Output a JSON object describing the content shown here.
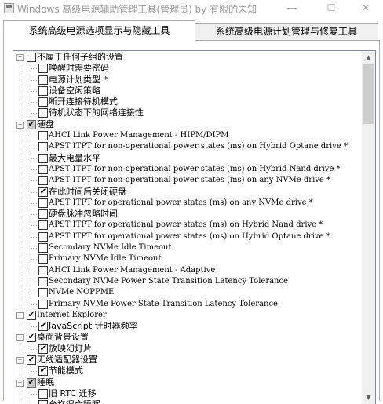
{
  "window": {
    "title": "Windows 高级电源辅助管理工具(管理员)  by 有限的未知",
    "minimize_glyph": "—",
    "maximize_glyph": "☐",
    "close_glyph": "✕"
  },
  "tabs": [
    {
      "label": "系统高级电源选项显示与隐藏工具",
      "active": true
    },
    {
      "label": "系统高级电源计划管理与修复工具",
      "active": false
    }
  ],
  "tree": [
    {
      "label": "不属于任何子组的设置",
      "level": 0,
      "expander": "−",
      "check": "none",
      "mono": false
    },
    {
      "label": "唤醒时需要密码",
      "level": 1,
      "check": "none",
      "mono": false
    },
    {
      "label": "电源计划类型 *",
      "level": 1,
      "check": "none",
      "mono": false
    },
    {
      "label": "设备空闲策略",
      "level": 1,
      "check": "none",
      "mono": false
    },
    {
      "label": "断开连接待机模式",
      "level": 1,
      "check": "none",
      "mono": false
    },
    {
      "label": "待机状态下的网络连接性",
      "level": 1,
      "check": "none",
      "mono": false
    },
    {
      "label": "硬盘",
      "level": 0,
      "expander": "−",
      "check": "partial",
      "mono": false
    },
    {
      "label": "AHCI Link Power Management - HIPM/DIPM",
      "level": 1,
      "check": "none",
      "mono": true
    },
    {
      "label": "APST ITPT for non-operational power states (ms) on Hybrid Optane drive *",
      "level": 1,
      "check": "none",
      "mono": true
    },
    {
      "label": "最大电量水平",
      "level": 1,
      "check": "none",
      "mono": false
    },
    {
      "label": "APST ITPT for non-operational power states (ms) on Hybrid Nand drive *",
      "level": 1,
      "check": "none",
      "mono": true
    },
    {
      "label": "APST ITPT for non-operational power states (ms) on any NVMe drive *",
      "level": 1,
      "check": "none",
      "mono": true
    },
    {
      "label": "在此时间后关闭硬盘",
      "level": 1,
      "check": "checked",
      "mono": false
    },
    {
      "label": "APST ITPT for operational power states (ms) on any NVMe drive *",
      "level": 1,
      "check": "none",
      "mono": true
    },
    {
      "label": "硬盘脉冲忽略时间",
      "level": 1,
      "check": "none",
      "mono": false
    },
    {
      "label": "APST ITPT for operational power states (ms) on Hybrid Nand drive *",
      "level": 1,
      "check": "none",
      "mono": true
    },
    {
      "label": "APST ITPT for operational power states (ms) on Hybrid Optane drive *",
      "level": 1,
      "check": "none",
      "mono": true
    },
    {
      "label": "Secondary NVMe Idle Timeout",
      "level": 1,
      "check": "none",
      "mono": true
    },
    {
      "label": "Primary NVMe Idle Timeout",
      "level": 1,
      "check": "none",
      "mono": true
    },
    {
      "label": "AHCI Link Power Management - Adaptive",
      "level": 1,
      "check": "none",
      "mono": true
    },
    {
      "label": "Secondary NVMe Power State Transition Latency Tolerance",
      "level": 1,
      "check": "none",
      "mono": true
    },
    {
      "label": "NVMe NOPPME",
      "level": 1,
      "check": "none",
      "mono": true
    },
    {
      "label": "Primary NVMe Power State Transition Latency Tolerance",
      "level": 1,
      "check": "none",
      "mono": true
    },
    {
      "label": "Internet Explorer",
      "level": 0,
      "expander": "−",
      "check": "checked",
      "mono": true
    },
    {
      "label": "JavaScript 计时器频率",
      "level": 1,
      "check": "checked",
      "mono": false
    },
    {
      "label": "桌面背景设置",
      "level": 0,
      "expander": "−",
      "check": "checked",
      "mono": false
    },
    {
      "label": "放映幻灯片",
      "level": 1,
      "check": "checked",
      "mono": false
    },
    {
      "label": "无线适配器设置",
      "level": 0,
      "expander": "−",
      "check": "checked",
      "mono": false
    },
    {
      "label": "节能模式",
      "level": 1,
      "check": "checked",
      "mono": false
    },
    {
      "label": "睡眠",
      "level": 0,
      "expander": "−",
      "check": "partial",
      "mono": false
    },
    {
      "label": "旧 RTC 迁移",
      "level": 1,
      "check": "none",
      "mono": false
    },
    {
      "label": "允许混合睡眠",
      "level": 1,
      "check": "none",
      "mono": false
    }
  ],
  "scrollbar": {
    "up_glyph": "▲",
    "down_glyph": "▼",
    "position_fraction": 0.0
  }
}
